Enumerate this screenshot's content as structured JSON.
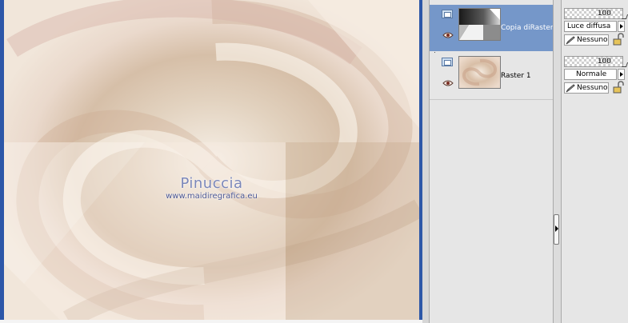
{
  "canvas": {
    "watermark_title": "Pinuccia",
    "watermark_url": "www.maidiregrafica.eu"
  },
  "layers": [
    {
      "name": "Copia diRaster",
      "selected": true,
      "visible": true,
      "thumbnail": "dark-gradient-corner",
      "opacity": "100",
      "blend_mode": "Luce diffusa",
      "mask": "Nessuno"
    },
    {
      "name": "Raster 1",
      "selected": false,
      "visible": true,
      "thumbnail": "beige-swirl",
      "opacity": "100",
      "blend_mode": "Normale",
      "mask": "Nessuno"
    }
  ],
  "icons": {
    "layer_type": "raster-layer-icon",
    "visibility": "eye-icon",
    "mask": "brush-icon",
    "lock": "lock-icon",
    "blend_dropdown": "chevron-right-icon",
    "splitter": "collapse-arrow-icon"
  },
  "colors": {
    "canvas_frame": "#2d57a8",
    "selected_row": "#7597c9",
    "panel_bg": "#e6e6e6",
    "swirl_light": "#efe4d7",
    "swirl_dark": "#c9ab8e"
  }
}
